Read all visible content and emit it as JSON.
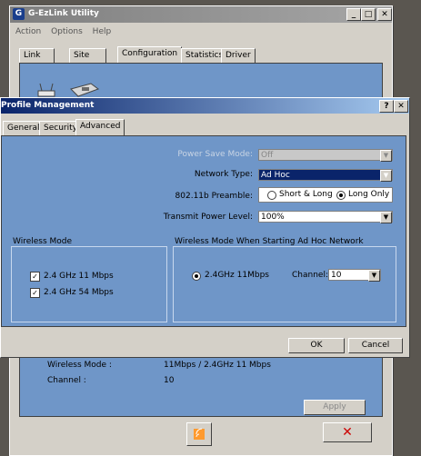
{
  "bg_window": {
    "title": "G-EzLink Utility",
    "logo": "G",
    "menu": [
      "Action",
      "Options",
      "Help"
    ],
    "tabs": [
      "Link Status",
      "Site Survey",
      "Configuration",
      "Statistics",
      "Driver Info"
    ],
    "active_tab": "Configuration",
    "info_rows": [
      {
        "label": "Wireless Mode :",
        "value": "11Mbps / 2.4GHz 11 Mbps"
      },
      {
        "label": "Channel :",
        "value": "10"
      }
    ],
    "apply_label": "Apply",
    "minimize_glyph": "_",
    "maximize_glyph": "□",
    "close_glyph": "✕",
    "close_button_glyph": "✕"
  },
  "dialog": {
    "title": "Profile Management",
    "help_glyph": "?",
    "close_glyph": "✕",
    "tabs": [
      "General",
      "Security",
      "Advanced"
    ],
    "active_tab": "Advanced",
    "power_save": {
      "label": "Power Save Mode:",
      "value": "Off"
    },
    "network_type": {
      "label": "Network Type:",
      "value": "Ad Hoc"
    },
    "preamble": {
      "label": "802.11b Preamble:",
      "option1": "Short & Long",
      "option2": "Long Only",
      "selected": "Long Only"
    },
    "tx_power": {
      "label": "Transmit Power Level:",
      "value": "100%"
    },
    "wireless_mode": {
      "title": "Wireless Mode",
      "options": [
        {
          "label": "2.4 GHz 11 Mbps",
          "checked": true
        },
        {
          "label": "2.4 GHz 54 Mbps",
          "checked": true
        }
      ]
    },
    "adhoc_mode": {
      "title": "Wireless Mode When Starting Ad Hoc Network",
      "radio_label": "2.4GHz 11Mbps",
      "channel_label": "Channel:",
      "channel_value": "10"
    },
    "ok_label": "OK",
    "cancel_label": "Cancel"
  },
  "colors": {
    "panel_blue": "#6f96c8",
    "title_blue": "#0a246a",
    "close_red": "#cc0000"
  }
}
